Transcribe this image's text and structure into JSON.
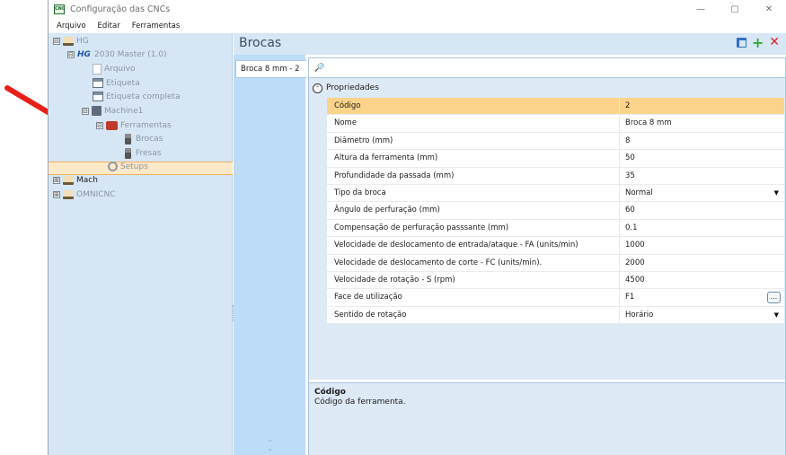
{
  "window": {
    "title": "Configuração das CNCs",
    "app_icon_text": "CNC",
    "controls": {
      "minimize": "—",
      "maximize": "▢",
      "close": "✕"
    }
  },
  "menu": [
    "Arquivo",
    "Editar",
    "Ferramentas"
  ],
  "tree": {
    "items": [
      {
        "label": "HG",
        "expander": "⊟",
        "icon": "house-icon"
      },
      {
        "prefix": "HG",
        "label": "2030 Master (1.0)",
        "expander": "⊟",
        "icon": "hg-logo-icon"
      },
      {
        "label": "Arquivo",
        "icon": "document-icon"
      },
      {
        "label": "Etiqueta",
        "icon": "label-icon"
      },
      {
        "label": "Etiqueta completa",
        "icon": "label-icon"
      },
      {
        "label": "Machine1",
        "expander": "⊟",
        "icon": "machine-icon"
      },
      {
        "label": "Ferramentas",
        "expander": "⊟",
        "icon": "toolbox-icon"
      },
      {
        "label": "Brocas",
        "icon": "drill-bit-icon",
        "selected": true
      },
      {
        "label": "Fresas",
        "icon": "mill-bit-icon"
      },
      {
        "label": "Setups",
        "icon": "gear-icon"
      },
      {
        "label": "Mach",
        "expander": "⊞",
        "icon": "house-icon"
      },
      {
        "label": "OMNICNC",
        "expander": "⊞",
        "icon": "house-icon"
      }
    ]
  },
  "header": {
    "title": "Brocas",
    "actions": [
      "copy-icon",
      "add-icon",
      "delete-icon"
    ]
  },
  "tabs": [
    "Broca 8 mm - 2"
  ],
  "property_grid": {
    "search_icon": "🔎",
    "category": "Propriedades",
    "rows": [
      {
        "name": "Código",
        "value": "2",
        "selected": true
      },
      {
        "name": "Nome",
        "value": "Broca 8 mm"
      },
      {
        "name": "Diâmetro (mm)",
        "value": "8"
      },
      {
        "name": "Altura da ferramenta (mm)",
        "value": "50"
      },
      {
        "name": "Profundidade da passada (mm)",
        "value": "35"
      },
      {
        "name": "Tipo da broca",
        "value": "Normal",
        "dropdown": true
      },
      {
        "name": "Ângulo de perfuração (mm)",
        "value": "60"
      },
      {
        "name": "Compensação de perfuração passsante (mm)",
        "value": "0.1"
      },
      {
        "name": "Velocidade de deslocamento de entrada/ataque - FA (units/min)",
        "value": "1000"
      },
      {
        "name": "Velocidade de deslocamento de corte - FC (units/min).",
        "value": "2000"
      },
      {
        "name": "Velocidade de rotação - S (rpm)",
        "value": "4500"
      },
      {
        "name": "Face de utilização",
        "value": "F1",
        "ellipsis": "..."
      },
      {
        "name": "Sentido de rotação",
        "value": "Horário",
        "dropdown": true
      }
    ]
  },
  "description": {
    "title": "Código",
    "text": "Código da ferramenta."
  },
  "colors": {
    "tree_bg": "#d6e6f5",
    "selection": "#fbd38a",
    "arrow": "#e8201a"
  }
}
